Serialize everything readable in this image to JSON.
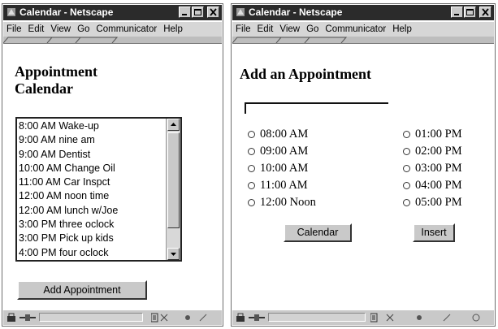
{
  "colors": {
    "titlebar": "#2b2b2b",
    "chrome": "#c9c9c9",
    "menubar": "#d6d6d6",
    "page": "#ffffff"
  },
  "window1": {
    "title": "Calendar - Netscape",
    "menu": {
      "file": "File",
      "edit": "Edit",
      "view": "View",
      "go": "Go",
      "communicator": "Communicator",
      "help": "Help"
    },
    "heading_line1": "Appointment",
    "heading_line2": "Calendar",
    "appointments": [
      "8:00 AM Wake-up",
      "9:00 AM nine am",
      "9:00 AM Dentist",
      "10:00 AM Change Oil",
      "11:00 AM Car Inspct",
      "12:00 AM noon time",
      "12:00 AM lunch w/Joe",
      "3:00 PM three oclock",
      "3:00 PM Pick up kids",
      "4:00 PM four oclock"
    ],
    "add_button": "Add Appointment"
  },
  "window2": {
    "title": "Calendar - Netscape",
    "menu": {
      "file": "File",
      "edit": "Edit",
      "view": "View",
      "go": "Go",
      "communicator": "Communicator",
      "help": "Help"
    },
    "heading": "Add an Appointment",
    "description_value": "",
    "times_left": [
      "08:00 AM",
      "09:00 AM",
      "10:00 AM",
      "11:00 AM",
      "12:00 Noon"
    ],
    "times_right": [
      "01:00 PM",
      "02:00 PM",
      "03:00 PM",
      "04:00 PM",
      "05:00 PM"
    ],
    "calendar_button": "Calendar",
    "insert_button": "Insert"
  }
}
